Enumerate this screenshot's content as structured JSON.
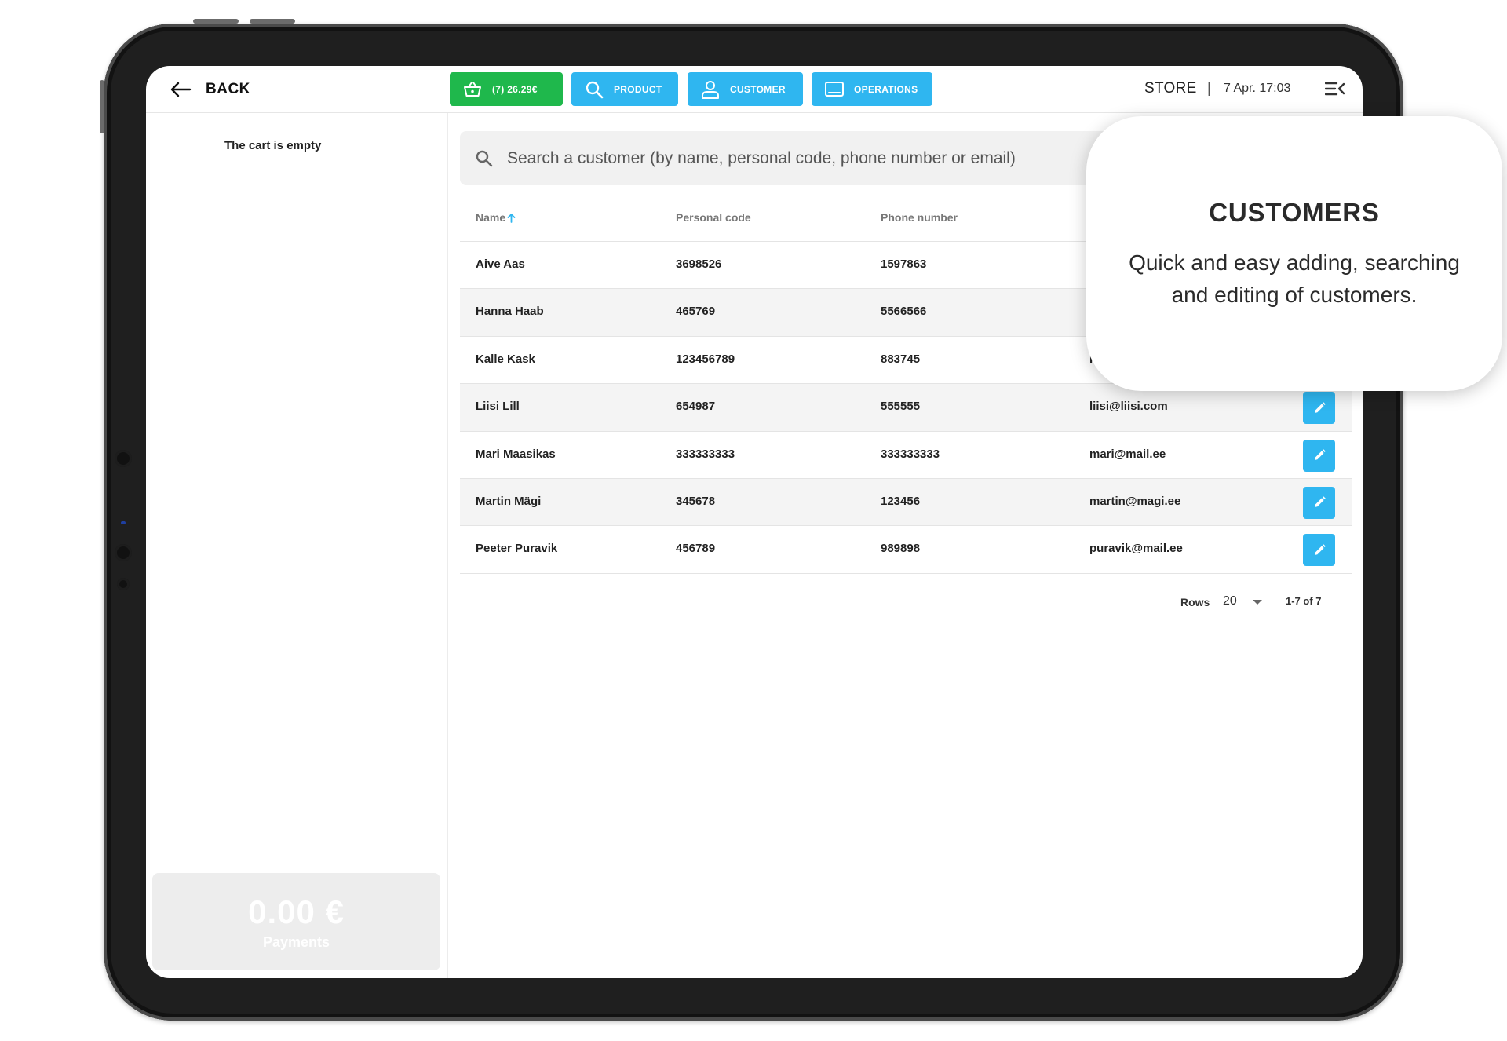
{
  "topbar": {
    "back_label": "BACK",
    "cart_label": "(7) 26.29€",
    "product_label": "PRODUCT",
    "customer_label": "CUSTOMER",
    "operations_label": "OPERATIONS",
    "store_label": "STORE",
    "separator": "|",
    "datetime": "7 Apr. 17:03"
  },
  "cart": {
    "empty_message": "The cart is empty",
    "payments_amount": "0.00 €",
    "payments_label": "Payments"
  },
  "search": {
    "placeholder": "Search a customer (by name, personal code, phone number or email)",
    "value": ""
  },
  "table": {
    "columns": [
      "Name",
      "Personal code",
      "Phone number"
    ],
    "rows": [
      {
        "name": "Aive Aas",
        "code": "3698526",
        "phone": "1597863",
        "email": ""
      },
      {
        "name": "Hanna Haab",
        "code": "465769",
        "phone": "5566566",
        "email": ""
      },
      {
        "name": "Kalle Kask",
        "code": "123456789",
        "phone": "883745",
        "email": "ka"
      },
      {
        "name": "Liisi Lill",
        "code": "654987",
        "phone": "555555",
        "email": "liisi@liisi.com"
      },
      {
        "name": "Mari Maasikas",
        "code": "333333333",
        "phone": "333333333",
        "email": "mari@mail.ee"
      },
      {
        "name": "Martin Mägi",
        "code": "345678",
        "phone": "123456",
        "email": "martin@magi.ee"
      },
      {
        "name": "Peeter Puravik",
        "code": "456789",
        "phone": "989898",
        "email": "puravik@mail.ee"
      }
    ]
  },
  "pagination": {
    "rows_label": "Rows",
    "rows_value": "20",
    "range": "1-7 of 7"
  },
  "callout": {
    "title": "CUSTOMERS",
    "text": "Quick and easy adding, searching and editing of customers."
  },
  "colors": {
    "cart_green": "#1fb84c",
    "accent_blue": "#2fb6f0",
    "frame": "#1f1f1f"
  },
  "icons": {
    "back": "arrow-left-icon",
    "cart": "basket-icon",
    "product": "search-icon",
    "customer": "user-icon",
    "operations": "monitor-icon",
    "menu": "menu-collapse-icon",
    "sort": "arrow-up-icon",
    "edit": "pencil-icon"
  }
}
